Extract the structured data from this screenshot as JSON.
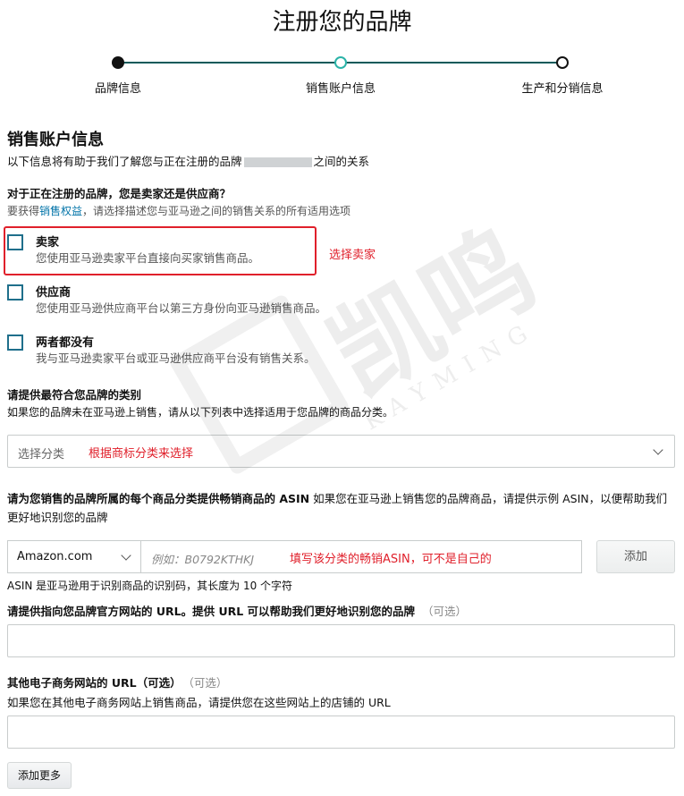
{
  "page_title": "注册您的品牌",
  "stepper": {
    "steps": [
      "品牌信息",
      "销售账户信息",
      "生产和分销信息"
    ]
  },
  "section": {
    "title": "销售账户信息",
    "desc_prefix": "以下信息将有助于我们了解您与正在注册的品牌",
    "desc_suffix": "之间的关系"
  },
  "role_question": {
    "title": "对于正在注册的品牌，您是卖家还是供应商？",
    "desc_prefix": "要获得",
    "desc_link": "销售权益",
    "desc_suffix": "，请选择描述您与亚马逊之间的销售关系的所有适用选项",
    "options": [
      {
        "label": "卖家",
        "desc": "您使用亚马逊卖家平台直接向买家销售商品。"
      },
      {
        "label": "供应商",
        "desc": "您使用亚马逊供应商平台以第三方身份向亚马逊销售商品。"
      },
      {
        "label": "两者都没有",
        "desc": "我与亚马逊卖家平台或亚马逊供应商平台没有销售关系。"
      }
    ]
  },
  "category": {
    "title": "请提供最符合您品牌的类别",
    "desc": "如果您的品牌未在亚马逊上销售，请从以下列表中选择适用于您品牌的商品分类。",
    "select_value": "选择分类"
  },
  "asin": {
    "title_bold": "请为您销售的品牌所属的每个商品分类提供畅销商品的 ASIN",
    "title_rest": " 如果您在亚马逊上销售您的品牌商品，请提供示例 ASIN，以便帮助我们更好地识别您的品牌",
    "marketplace": "Amazon.com",
    "placeholder": "例如：B0792KTHKJ",
    "add_button": "添加",
    "note": "ASIN 是亚马逊用于识别商品的识别码，其长度为 10 个字符"
  },
  "website": {
    "title": "请提供指向您品牌官方网站的 URL。提供 URL 可以帮助我们更好地识别您的品牌",
    "optional": "（可选）"
  },
  "other_ecommerce": {
    "title": "其他电子商务网站的 URL（可选）",
    "optional": "（可选）",
    "desc": "如果您在其他电子商务网站上销售商品，请提供您在这些网站上的店铺的 URL",
    "add_more_button": "添加更多"
  },
  "annotations": {
    "select_seller": "选择卖家",
    "category_hint": "根据商标分类来选择",
    "asin_hint": "填写该分类的畅销ASIN，可不是自己的"
  },
  "watermark": {
    "cn": "凯鸣",
    "en": "KAYMING"
  },
  "colors": {
    "annotation_red": "#e0202b",
    "checkbox_border": "#1f6f8b",
    "stepper_line": "#0a5a5a",
    "current_step": "#2bb3a8",
    "link": "#0073a8"
  }
}
